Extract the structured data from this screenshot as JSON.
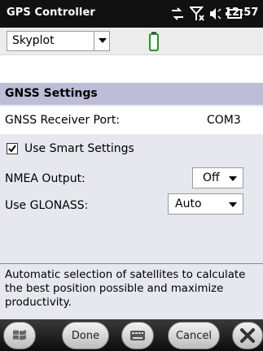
{
  "statusbar": {
    "title": "GPS Controller",
    "time": "12:57"
  },
  "toolbar": {
    "view_selector": "Skyplot"
  },
  "section": {
    "title": "GNSS Settings"
  },
  "receiver_port": {
    "label": "GNSS Receiver Port:",
    "value": "COM3"
  },
  "smart_settings": {
    "label": "Use Smart Settings",
    "checked": true
  },
  "nmea_output": {
    "label": "NMEA Output:",
    "selected": "Off"
  },
  "glonass": {
    "label": "Use GLONASS:",
    "selected": "Auto"
  },
  "help_text": "Automatic selection of satellites to calculate the best position possible and maximize productivity.",
  "softkeys": {
    "done": "Done",
    "cancel": "Cancel"
  },
  "colors": {
    "header": "#bdbdd7",
    "panel": "#e7e7ef",
    "statusbar": "#111111"
  }
}
